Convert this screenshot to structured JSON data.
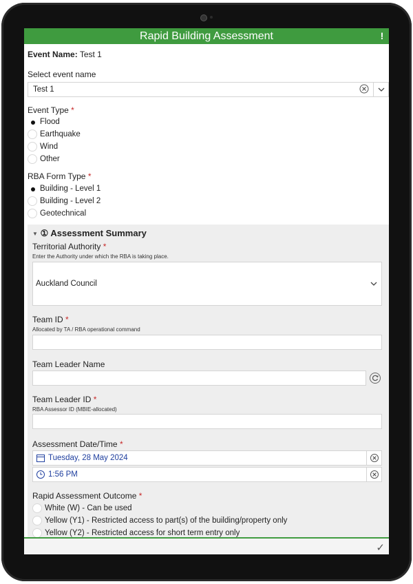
{
  "app": {
    "title": "Rapid Building Assessment"
  },
  "event_name": {
    "label": "Event Name:",
    "value": "Test 1"
  },
  "select_event": {
    "label": "Select event name",
    "value": "Test 1"
  },
  "event_type": {
    "label": "Event Type",
    "required": "*",
    "options": [
      "Flood",
      "Earthquake",
      "Wind",
      "Other"
    ],
    "selected": "Flood"
  },
  "rba_form_type": {
    "label": "RBA Form Type",
    "required": "*",
    "options": [
      "Building - Level 1",
      "Building - Level 2",
      "Geotechnical"
    ],
    "selected": "Building - Level 1"
  },
  "section": {
    "title": "① Assessment Summary",
    "territorial_authority": {
      "label": "Territorial Authority",
      "required": "*",
      "hint": "Enter the Authority under which the RBA is taking place.",
      "value": "Auckland Council"
    },
    "team_id": {
      "label": "Team ID",
      "required": "*",
      "hint": "Allocated by TA / RBA operational command",
      "value": ""
    },
    "team_leader_name": {
      "label": "Team Leader Name",
      "value": ""
    },
    "team_leader_id": {
      "label": "Team Leader ID",
      "required": "*",
      "hint": "RBA Assessor ID (MBIE-allocated)",
      "value": ""
    },
    "assessment_datetime": {
      "label": "Assessment Date/Time",
      "required": "*",
      "date": "Tuesday, 28 May 2024",
      "time": "1:56 PM"
    },
    "outcome": {
      "label": "Rapid Assessment Outcome",
      "required": "*",
      "options": [
        "White (W) - Can be used",
        "Yellow (Y1) - Restricted access to part(s) of the building/property only",
        "Yellow (Y2) - Restricted access for short term entry only"
      ]
    }
  },
  "icons": {
    "alert": "exclamation-icon",
    "clear": "clear-circle-icon",
    "dropdown": "chevron-down-icon",
    "refresh": "refresh-icon",
    "calendar": "calendar-icon",
    "clock": "clock-icon",
    "submit": "checkmark-icon"
  },
  "colors": {
    "header": "#3f9b3f",
    "link_value": "#1f3f9f",
    "required": "#c62828"
  }
}
